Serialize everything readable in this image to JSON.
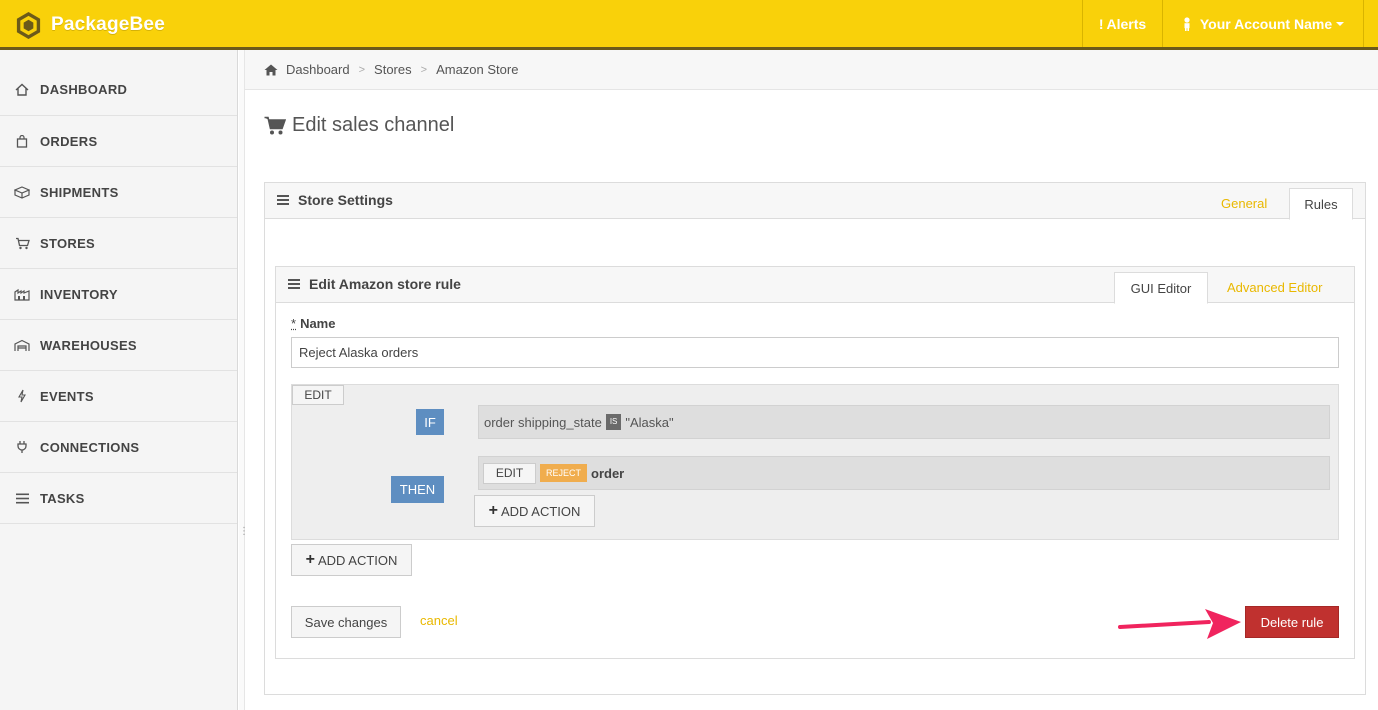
{
  "app": {
    "name": "PackageBee"
  },
  "topbar": {
    "alerts_label": "Alerts",
    "account_label": "Your Account Name"
  },
  "sidebar": {
    "items": [
      {
        "label": "DASHBOARD",
        "icon": "home-icon"
      },
      {
        "label": "ORDERS",
        "icon": "shopping-bag-icon"
      },
      {
        "label": "SHIPMENTS",
        "icon": "package-icon"
      },
      {
        "label": "STORES",
        "icon": "cart-icon"
      },
      {
        "label": "INVENTORY",
        "icon": "inventory-icon"
      },
      {
        "label": "WAREHOUSES",
        "icon": "warehouse-icon"
      },
      {
        "label": "EVENTS",
        "icon": "lightning-icon"
      },
      {
        "label": "CONNECTIONS",
        "icon": "plug-icon"
      },
      {
        "label": "TASKS",
        "icon": "list-icon"
      }
    ]
  },
  "breadcrumb": {
    "items": [
      "Dashboard",
      "Stores",
      "Amazon Store"
    ]
  },
  "page": {
    "title": "Edit sales channel"
  },
  "store_settings": {
    "title": "Store Settings",
    "tabs": [
      "General",
      "Rules"
    ],
    "active_tab": "Rules"
  },
  "rule_editor": {
    "title": "Edit Amazon store rule",
    "tabs": [
      "GUI Editor",
      "Advanced Editor"
    ],
    "active_tab": "GUI Editor",
    "name_required_mark": "*",
    "name_label": "Name",
    "name_value": "Reject Alaska orders",
    "edit_label": "EDIT",
    "if_label": "IF",
    "condition": {
      "field": "order shipping_state",
      "operator": "IS",
      "value": "\"Alaska\""
    },
    "then_label": "THEN",
    "action": {
      "edit_label": "EDIT",
      "verb": "REJECT",
      "target": "order"
    },
    "add_action_inner": "ADD ACTION",
    "add_action_outer": "ADD ACTION",
    "save_label": "Save changes",
    "cancel_label": "cancel",
    "delete_label": "Delete rule"
  },
  "colors": {
    "brand": "#f9d10a",
    "link": "#e9b800",
    "label_blue": "#5e8ec1",
    "reject": "#f0ad4e",
    "danger": "#c0312f",
    "annotation_arrow": "#f0245e"
  }
}
